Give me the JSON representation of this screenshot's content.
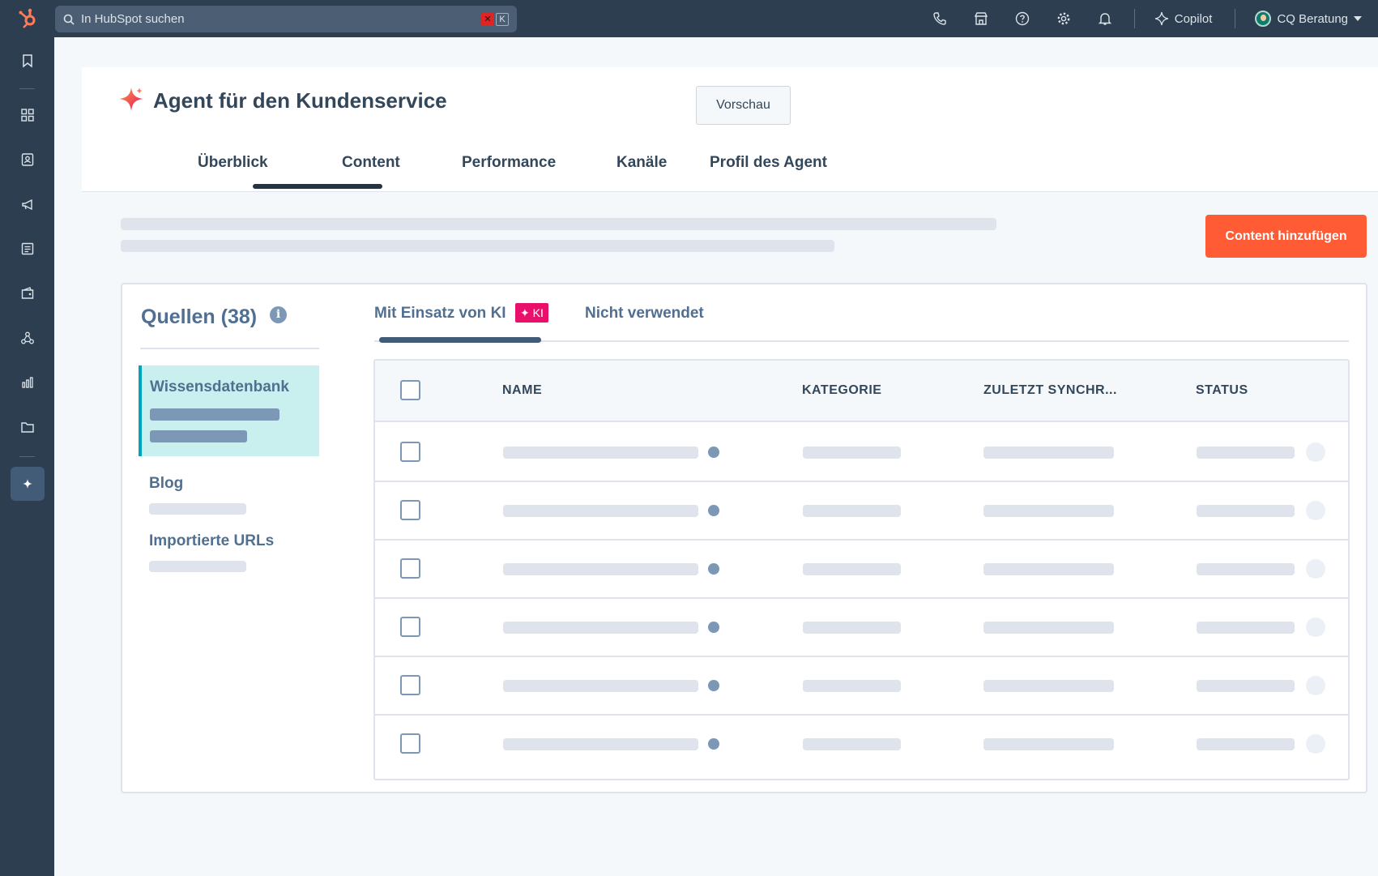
{
  "topbar": {
    "search_placeholder": "In HubSpot suchen",
    "shortcut_key": "K",
    "copilot_label": "Copilot",
    "account_name": "CQ Beratung"
  },
  "sidebar": {
    "items": [
      {
        "icon": "bookmark-icon"
      },
      {
        "icon": "grid-icon"
      },
      {
        "icon": "contacts-icon"
      },
      {
        "icon": "megaphone-icon"
      },
      {
        "icon": "content-icon"
      },
      {
        "icon": "commerce-icon"
      },
      {
        "icon": "network-icon"
      },
      {
        "icon": "reports-icon"
      },
      {
        "icon": "folder-icon"
      },
      {
        "icon": "ai-agent-icon",
        "active": true
      }
    ]
  },
  "header": {
    "title": "Agent für den Kundenservice",
    "preview_button": "Vorschau",
    "tabs": [
      {
        "label": "Überblick"
      },
      {
        "label": "Content",
        "active": true
      },
      {
        "label": "Performance"
      },
      {
        "label": "Kanäle"
      },
      {
        "label": "Profil des Agent"
      }
    ]
  },
  "actions": {
    "add_content_button": "Content hinzufügen"
  },
  "sources": {
    "title": "Quellen (38)",
    "info_glyph": "i",
    "items": [
      {
        "label": "Wissensdatenbank",
        "active": true
      },
      {
        "label": "Blog"
      },
      {
        "label": "Importierte URLs"
      }
    ]
  },
  "content_tabs": {
    "ai_tab": "Mit Einsatz von KI",
    "ai_badge": "✦ KI",
    "unused_tab": "Nicht verwendet"
  },
  "table": {
    "columns": [
      "NAME",
      "KATEGORIE",
      "ZULETZT SYNCHR...",
      "STATUS"
    ],
    "row_count": 6
  },
  "colors": {
    "nav_bg": "#2d3e50",
    "accent_orange": "#ff5c35",
    "ki_badge": "#e8106b",
    "active_source_bg": "#c9f0ee",
    "active_source_border": "#00a4bd"
  }
}
